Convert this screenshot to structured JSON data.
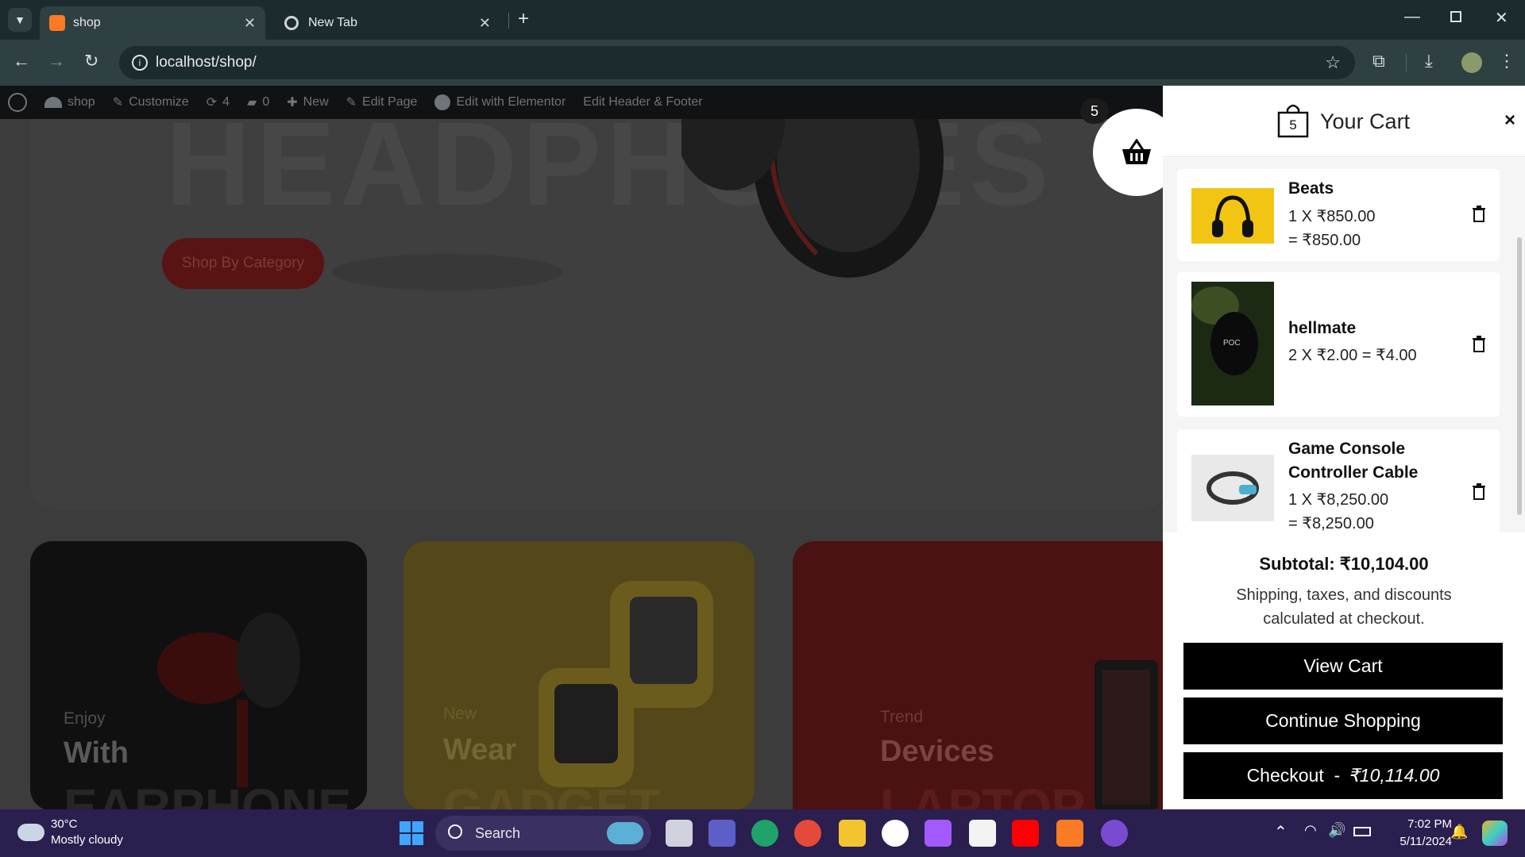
{
  "browser": {
    "tabs": [
      {
        "label": "shop",
        "active": true
      },
      {
        "label": "New Tab",
        "active": false
      }
    ],
    "url": "localhost/shop/"
  },
  "wp_admin_bar": {
    "site": "shop",
    "customize": "Customize",
    "updates": "4",
    "comments": "0",
    "new": "New",
    "edit_page": "Edit Page",
    "elementor": "Edit with Elementor",
    "header_footer": "Edit Header & Footer"
  },
  "hero": {
    "shop_by_category": "Shop By Category"
  },
  "categories": [
    {
      "small": "Enjoy",
      "big": "With",
      "ghost": "EARPHONE"
    },
    {
      "small": "New",
      "big": "Wear",
      "ghost": "GADGET"
    },
    {
      "small": "Trend",
      "big": "Devices",
      "ghost": "LAPTOP"
    }
  ],
  "floating_cart": {
    "count": "5"
  },
  "cart": {
    "title": "Your Cart",
    "bag_count": "5",
    "close": "×",
    "items": [
      {
        "name": "Beats",
        "qty_line1": "1 X ₹850.00",
        "qty_line2": "= ₹850.00"
      },
      {
        "name": "hellmate",
        "qty_line1": "2 X ₹2.00 = ₹4.00"
      },
      {
        "name_line1": "Game Console",
        "name_line2": "Controller Cable",
        "qty_line1": "1 X ₹8,250.00",
        "qty_line2": "= ₹8,250.00"
      }
    ],
    "subtotal": "Subtotal: ₹10,104.00",
    "note": "Shipping, taxes, and discounts calculated at checkout.",
    "view_cart": "View Cart",
    "continue_shopping": "Continue Shopping",
    "checkout_label": "Checkout  -",
    "checkout_amount": "₹10,114.00"
  },
  "taskbar": {
    "weather_temp": "30°C",
    "weather_desc": "Mostly cloudy",
    "search": "Search",
    "time": "7:02 PM",
    "date": "5/11/2024"
  }
}
